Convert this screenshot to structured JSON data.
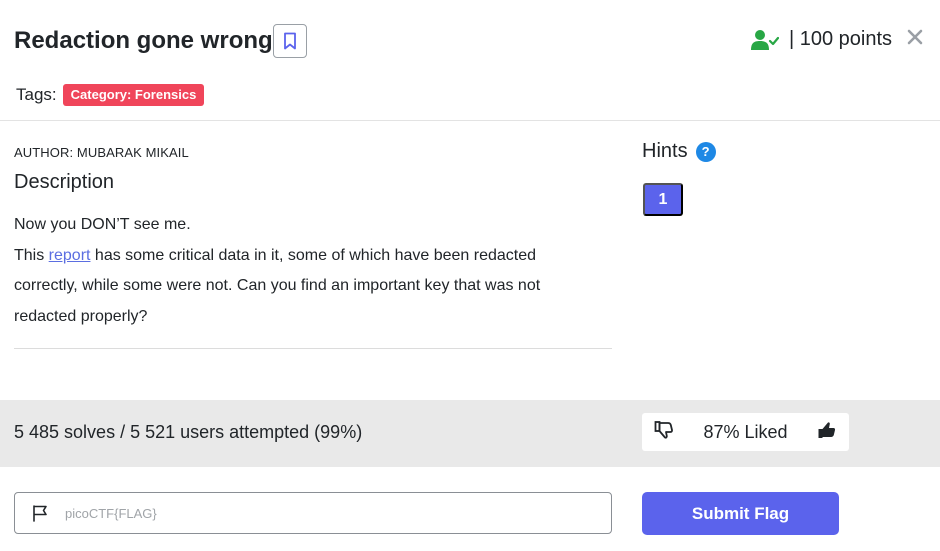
{
  "challenge": {
    "title": "Redaction gone wrong",
    "points": "| 100 points",
    "tags_label": "Tags:",
    "tag": "Category: Forensics"
  },
  "description": {
    "author": "AUTHOR: MUBARAK MIKAIL",
    "heading": "Description",
    "line1": "Now you DON’T see me.",
    "pre_link": "This ",
    "link_text": "report",
    "post_link": " has some critical data in it, some of which have been redacted correctly, while some were not. Can you find an important key that was not redacted properly?"
  },
  "hints": {
    "heading": "Hints",
    "help_glyph": "?",
    "items": [
      "1"
    ]
  },
  "stats": {
    "solves_text": "5 485 solves / 5 521 users attempted (99%)",
    "liked_text": "87% Liked"
  },
  "flag": {
    "placeholder": "picoCTF{FLAG}",
    "value": "",
    "submit_label": "Submit Flag"
  },
  "icons": {
    "bookmark": "bookmark-icon",
    "user_check": "user-check-icon",
    "close": "close-icon",
    "thumbs_down": "thumbs-down-icon",
    "thumbs_up": "thumbs-up-icon",
    "flag": "flag-icon"
  },
  "colors": {
    "tag_bg": "#f0455a",
    "primary": "#5b63ec",
    "link": "#5b6ee1",
    "solved_green": "#28a745",
    "help_blue": "#1e88e5",
    "band_gray": "#e9e9e9"
  }
}
